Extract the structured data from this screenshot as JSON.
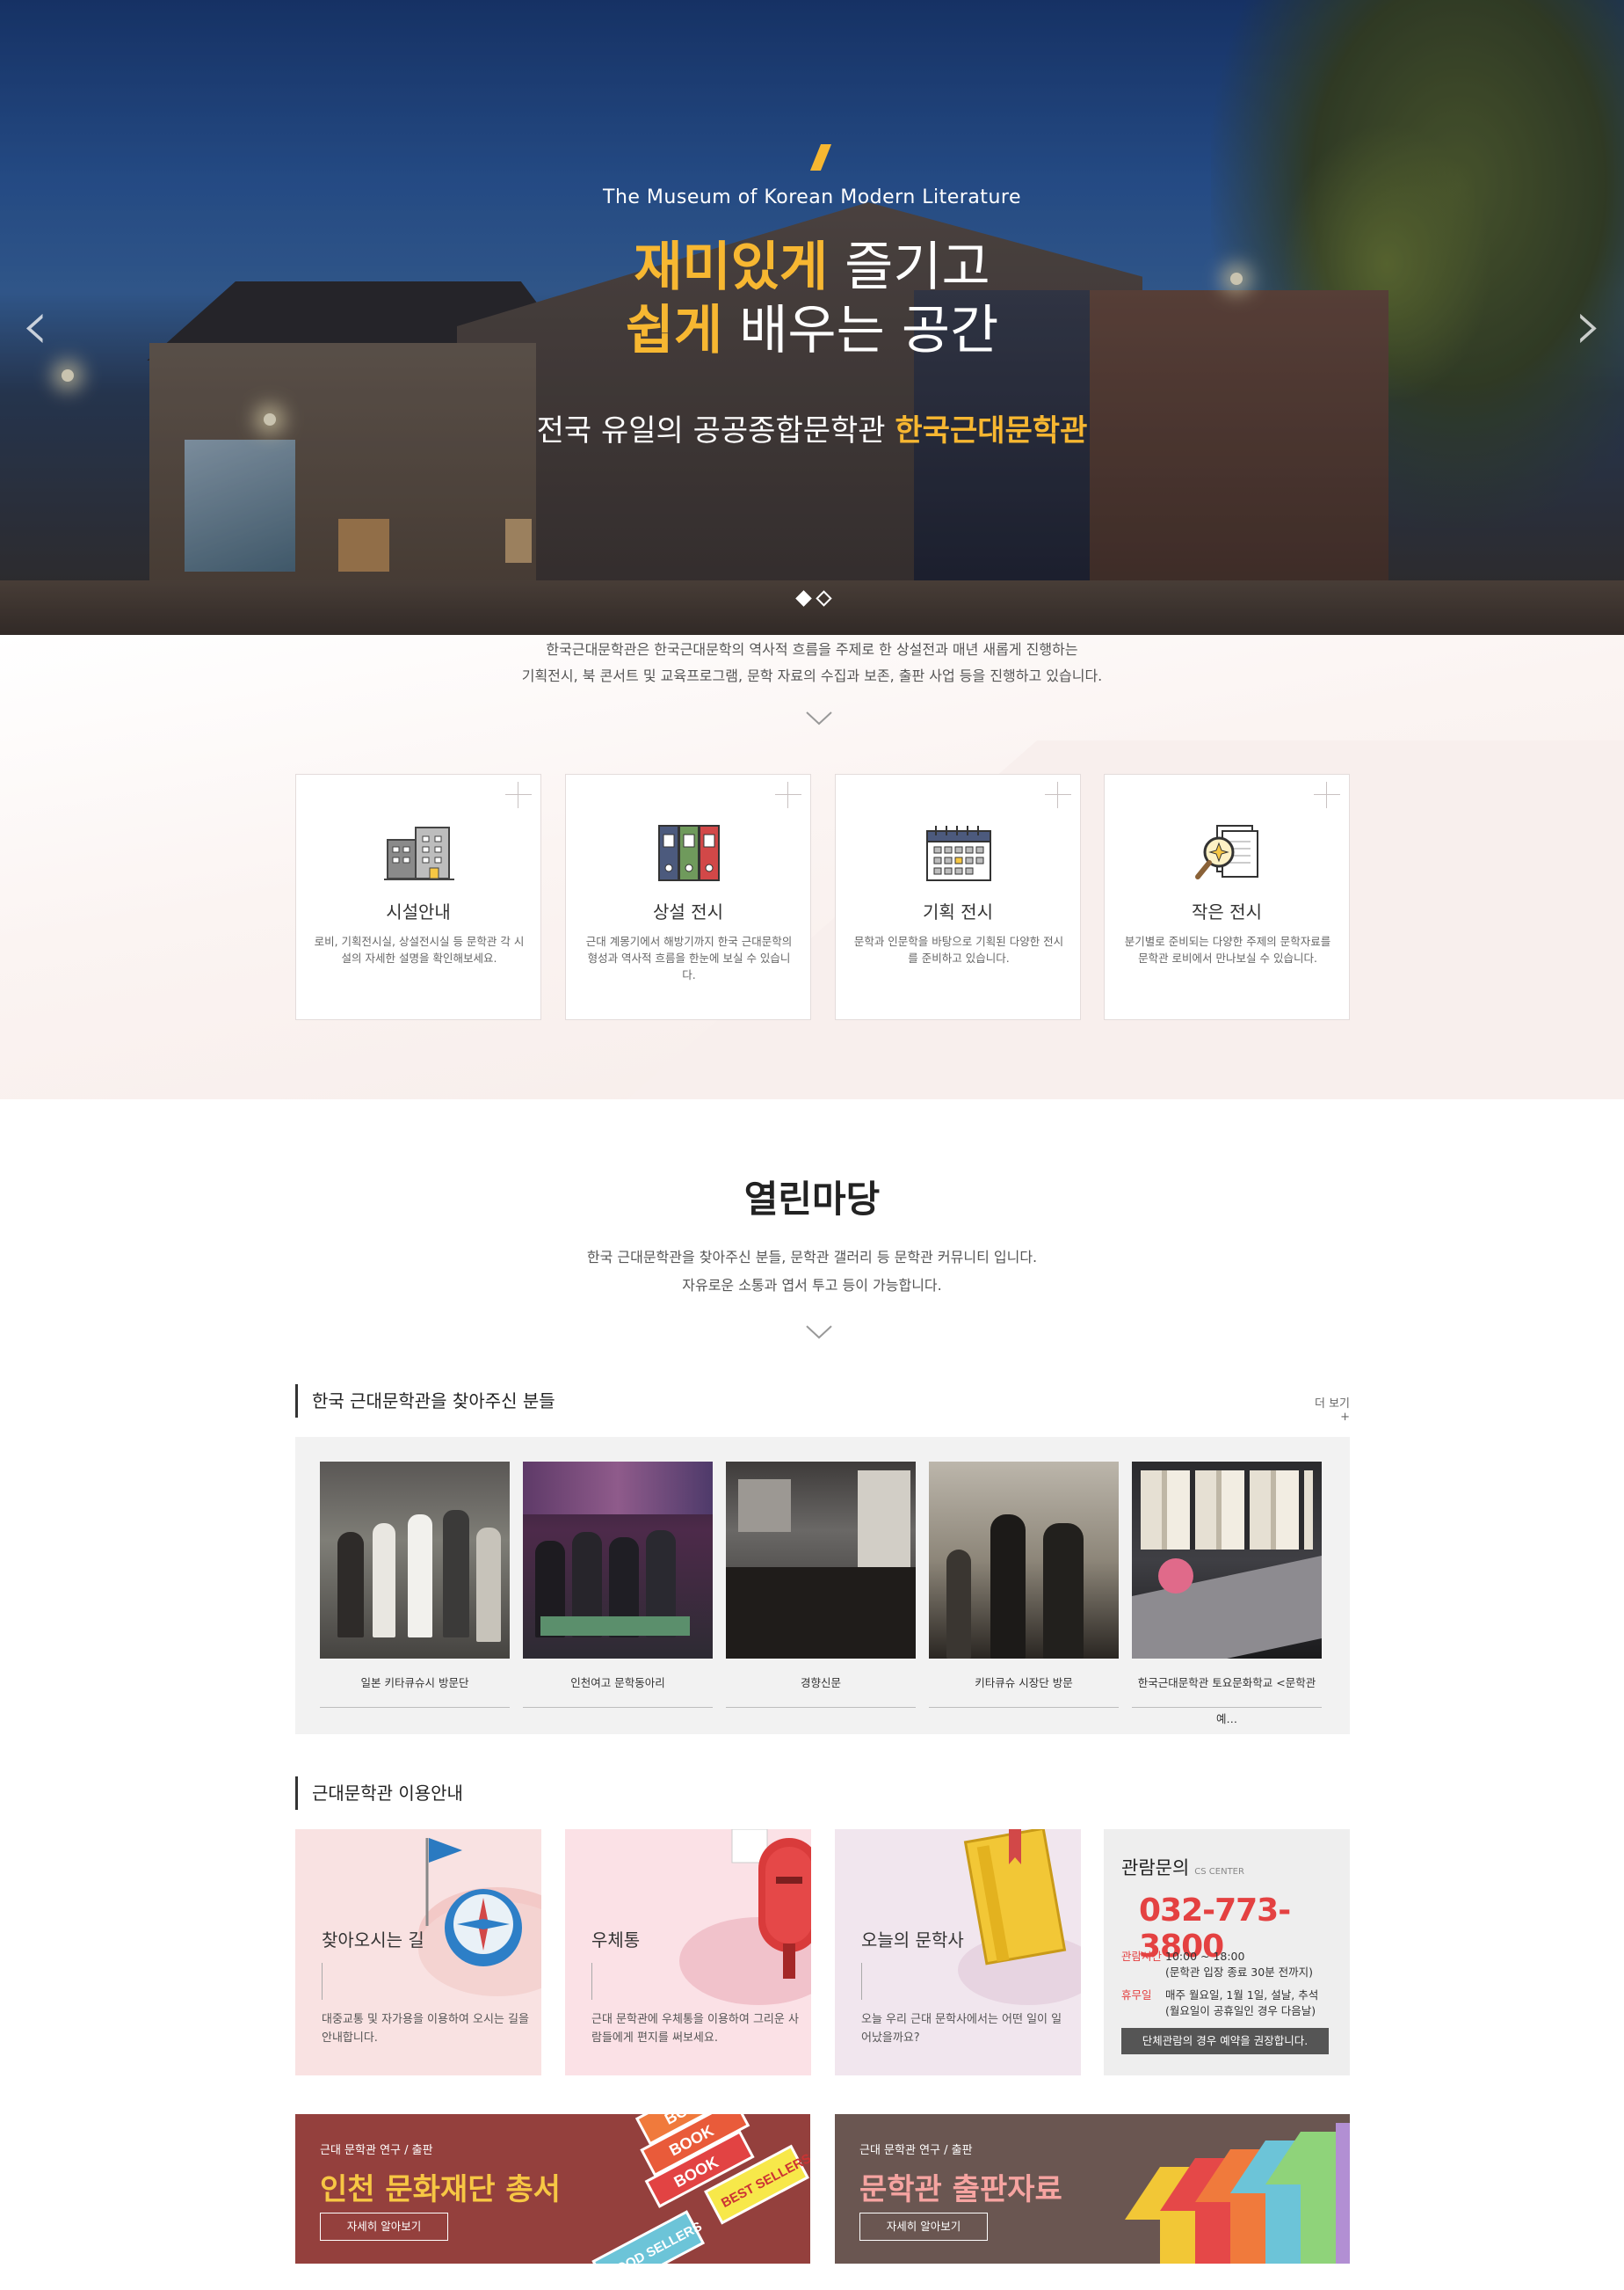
{
  "hero": {
    "subtitle": "The Museum of Korean Modern Literature",
    "headline_line1_accent": "재미있게",
    "headline_line1_rest": " 즐기고",
    "headline_line2_accent": "쉽게",
    "headline_line2_rest": " 배우는 공간",
    "tagline_prefix": "전국 유일의 공공종합문학관 ",
    "tagline_accent": "한국근대문학관",
    "prev_arrow": "‹",
    "next_arrow": "›",
    "slide_count": 2,
    "active_slide": 1,
    "accent_color": "#f7b731"
  },
  "intro": {
    "line1": "한국근대문학관은 한국근대문학의 역사적 흐름을 주제로 한 상설전과 매년 새롭게 진행하는",
    "line2": "기획전시, 북 콘서트 및 교육프로그램, 문학 자료의 수집과 보존, 출판 사업 등을 진행하고 있습니다.",
    "cards": [
      {
        "icon": "building-icon",
        "title": "시설안내",
        "text": "로비, 기획전시실, 상설전시실 등 문학관 각 시설의 자세한 설명을 확인해보세요."
      },
      {
        "icon": "binders-icon",
        "title": "상설 전시",
        "text": "근대 계몽기에서 해방기까지 한국 근대문학의 형성과 역사적 흐름을 한눈에 보실 수 있습니다."
      },
      {
        "icon": "calendar-icon",
        "title": "기획 전시",
        "text": "문학과 인문학을 바탕으로 기획된 다양한 전시를 준비하고 있습니다."
      },
      {
        "icon": "magnifier-document-icon",
        "title": "작은 전시",
        "text": "분기별로 준비되는 다양한 주제의 문학자료를 문학관 로비에서 만나보실 수 있습니다."
      }
    ]
  },
  "open_square": {
    "title": "열린마당",
    "desc_line1": "한국 근대문학관을 찾아주신 분들, 문학관 갤러리 등 문학관 커뮤니티 입니다.",
    "desc_line2": "자유로운 소통과 엽서 투고 등이 가능합니다."
  },
  "visitors": {
    "title": "한국 근대문학관을 찾아주신 분들",
    "more": "더 보기+",
    "items": [
      {
        "caption": "일본 키타큐슈시 방문단"
      },
      {
        "caption": "인천여고 문학동아리"
      },
      {
        "caption": "경향신문"
      },
      {
        "caption": "키타큐슈 시장단 방문"
      },
      {
        "caption": "한국근대문학관 토요문화학교 <문학관",
        "caption_overflow": "예…"
      }
    ]
  },
  "usage": {
    "title": "근대문학관 이용안내",
    "cards": [
      {
        "title": "찾아오시는 길",
        "text": "대중교통 및 자가용을 이용하여 오시는 길을 안내합니다.",
        "icon": "compass-flag-icon"
      },
      {
        "title": "우체통",
        "text": "근대 문학관에 우체통을 이용하여 그리운 사람들에게 편지를 써보세요.",
        "icon": "mailbox-icon"
      },
      {
        "title": "오늘의 문학사",
        "text": "오늘 우리 근대 문학사에서는 어떤 일이 일어났을까요?",
        "icon": "book-icon"
      }
    ],
    "cs": {
      "title": "관람문의",
      "title_small": "CS CENTER",
      "phone": "032-773-3800",
      "hours_label": "관람시간",
      "hours_value": "10:00 ~ 18:00",
      "hours_note": "(문학관 입장 종료 30분 전까지)",
      "closed_label": "휴무일",
      "closed_value": "매주 월요일, 1월 1일, 설날, 추석",
      "closed_note": "(월요일이 공휴일인 경우 다음날)",
      "group_notice": "단체관람의 경우 예약을 권장합니다."
    }
  },
  "banners": [
    {
      "small": "근대 문학관 연구 / 출판",
      "big": "인천 문화재단 총서",
      "button": "자세히 알아보기",
      "book_labels": [
        "BOOK",
        "BOOK",
        "BOOK",
        "BEST SELLERS",
        "GOOD SELLERS"
      ]
    },
    {
      "small": "근대 문학관 연구 / 출판",
      "big": "문학관 출판자료",
      "button": "자세히 알아보기"
    }
  ]
}
